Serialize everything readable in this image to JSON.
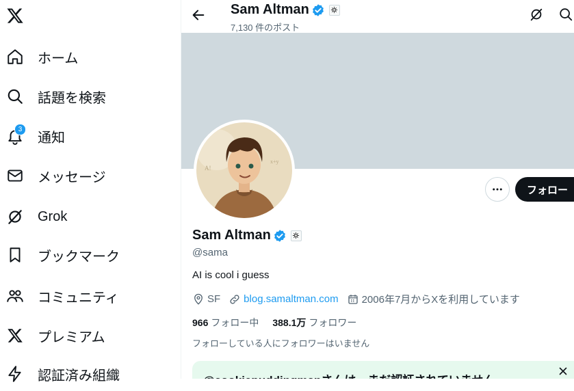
{
  "nav": {
    "items": [
      {
        "label": "ホーム",
        "icon": "home-icon"
      },
      {
        "label": "話題を検索",
        "icon": "search-icon"
      },
      {
        "label": "通知",
        "icon": "bell-icon",
        "badge": "3"
      },
      {
        "label": "メッセージ",
        "icon": "envelope-icon"
      },
      {
        "label": "Grok",
        "icon": "grok-icon"
      },
      {
        "label": "ブックマーク",
        "icon": "bookmark-icon"
      },
      {
        "label": "コミュニティ",
        "icon": "people-icon"
      },
      {
        "label": "プレミアム",
        "icon": "x-logo-icon"
      },
      {
        "label": "認証済み組織",
        "icon": "lightning-icon"
      }
    ]
  },
  "header": {
    "name": "Sam Altman",
    "post_count": "7,130 件のポスト"
  },
  "profile": {
    "name": "Sam Altman",
    "handle": "@sama",
    "bio": "AI is cool i guess",
    "location": "SF",
    "website": "blog.samaltman.com",
    "joined": "2006年7月からXを利用しています",
    "following_count": "966",
    "following_label": "フォロー中",
    "followers_count": "388.1万",
    "followers_label": "フォロワー",
    "followers_note": "フォローしている人にフォロワーはいません",
    "follow_button": "フォロー"
  },
  "notice": {
    "text": "@cookiepuddingmanさんは、まだ認証されていません"
  },
  "colors": {
    "accent": "#1d9bf0",
    "banner": "#cfd9de",
    "notice_bg": "#e6f9ee"
  }
}
